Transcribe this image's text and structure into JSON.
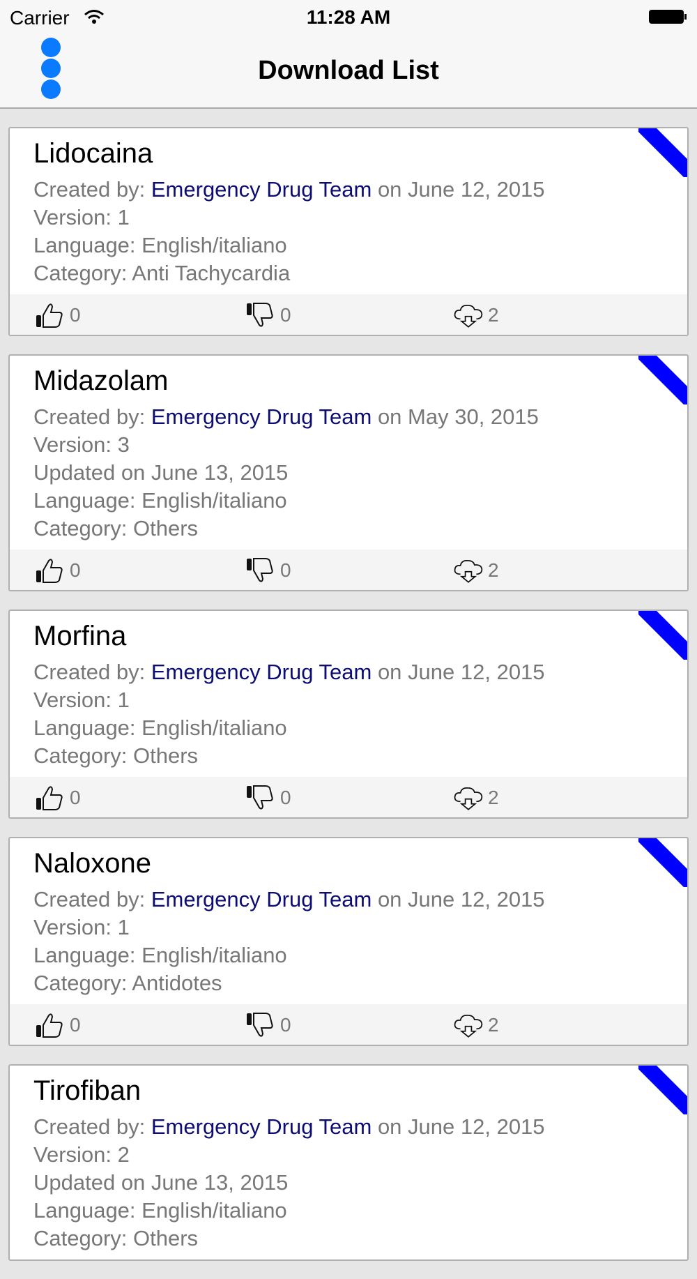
{
  "status_bar": {
    "carrier": "Carrier",
    "time": "11:28 AM"
  },
  "nav": {
    "title": "Download List"
  },
  "colors": {
    "accent": "#0a7aff",
    "ribbon": "#0000ff",
    "author": "#0c0c72"
  },
  "items": [
    {
      "title": "Lidocaina",
      "created_prefix": "Created by: ",
      "author": "Emergency Drug Team",
      "created_suffix": " on June 12, 2015",
      "version": "Version: 1",
      "language": "Language: English/italiano",
      "category": "Category: Anti Tachycardia",
      "likes": "0",
      "dislikes": "0",
      "downloads": "2"
    },
    {
      "title": "Midazolam",
      "created_prefix": "Created by: ",
      "author": "Emergency Drug Team",
      "created_suffix": " on May 30, 2015",
      "version": "Version: 3",
      "updated": "Updated on June 13, 2015",
      "language": "Language: English/italiano",
      "category": "Category: Others",
      "likes": "0",
      "dislikes": "0",
      "downloads": "2"
    },
    {
      "title": "Morfina",
      "created_prefix": "Created by: ",
      "author": "Emergency Drug Team",
      "created_suffix": " on June 12, 2015",
      "version": "Version: 1",
      "language": "Language: English/italiano",
      "category": "Category: Others",
      "likes": "0",
      "dislikes": "0",
      "downloads": "2"
    },
    {
      "title": "Naloxone",
      "created_prefix": "Created by: ",
      "author": "Emergency Drug Team",
      "created_suffix": " on June 12, 2015",
      "version": "Version: 1",
      "language": "Language: English/italiano",
      "category": "Category: Antidotes",
      "likes": "0",
      "dislikes": "0",
      "downloads": "2"
    },
    {
      "title": "Tirofiban",
      "created_prefix": "Created by: ",
      "author": "Emergency Drug Team",
      "created_suffix": " on June 12, 2015",
      "version": "Version: 2",
      "updated": "Updated on June 13, 2015",
      "language": "Language: English/italiano",
      "category": "Category: Others"
    }
  ]
}
